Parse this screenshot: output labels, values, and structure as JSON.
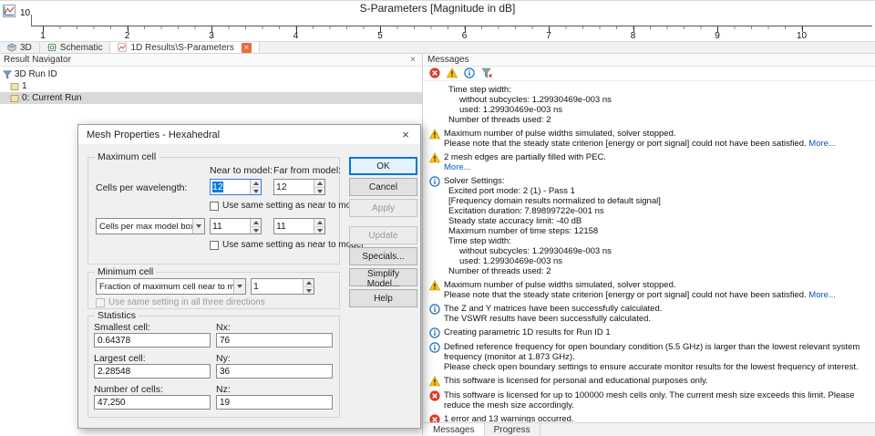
{
  "plot": {
    "title": "S-Parameters [Magnitude in dB]",
    "y_tick_label": "10",
    "x_tick_labels": [
      "1",
      "2",
      "3",
      "4",
      "5",
      "6",
      "7",
      "8",
      "9",
      "10"
    ]
  },
  "doc_tabs": [
    {
      "label": "3D",
      "active": false,
      "closable": false,
      "icon": "cube"
    },
    {
      "label": "Schematic",
      "active": false,
      "closable": false,
      "icon": "schematic"
    },
    {
      "label": "1D Results\\S-Parameters",
      "active": true,
      "closable": true,
      "icon": "chart"
    }
  ],
  "navigator": {
    "title": "Result Navigator",
    "items": [
      {
        "label": "3D Run ID",
        "icon": "funnel",
        "level": 0,
        "selected": false
      },
      {
        "label": "1",
        "icon": "run",
        "level": 1,
        "selected": false
      },
      {
        "label": "0: Current Run",
        "icon": "run",
        "level": 1,
        "selected": true
      }
    ]
  },
  "dialog": {
    "title": "Mesh Properties - Hexahedral",
    "maximum_cell": {
      "group_label": "Maximum cell",
      "col_near": "Near to model:",
      "col_far": "Far from model:",
      "cells_per_wavelength": {
        "label": "Cells per wavelength:",
        "near": "12",
        "far": "12"
      },
      "use_same_1": "Use same setting as near to model",
      "box_edge": {
        "selected": "Cells per max model box edge",
        "near": "11",
        "far": "11"
      },
      "use_same_2": "Use same setting as near to model"
    },
    "minimum_cell": {
      "group_label": "Minimum cell",
      "fraction": {
        "selected": "Fraction of maximum cell near to model",
        "value": "1"
      },
      "use_same_3": "Use same setting in all three directions"
    },
    "statistics": {
      "group_label": "Statistics",
      "smallest_cell": {
        "label": "Smallest cell:",
        "value": "0.64378"
      },
      "nx": {
        "label": "Nx:",
        "value": "76"
      },
      "largest_cell": {
        "label": "Largest cell:",
        "value": "2.28548"
      },
      "ny": {
        "label": "Ny:",
        "value": "36"
      },
      "number_of_cells": {
        "label": "Number of cells:",
        "value": "47,250"
      },
      "nz": {
        "label": "Nz:",
        "value": "19"
      }
    },
    "buttons": {
      "ok": "OK",
      "cancel": "Cancel",
      "apply": "Apply",
      "update": "Update",
      "specials": "Specials...",
      "simplify": "Simplify Model...",
      "help": "Help"
    }
  },
  "messages": {
    "title": "Messages",
    "items": [
      {
        "type": "none",
        "lines": [
          {
            "text": "Time step width:",
            "indent": 1
          },
          {
            "text": "without subcycles: 1.29930469e-003 ns",
            "indent": 2
          },
          {
            "text": "used: 1.29930469e-003 ns",
            "indent": 2
          },
          {
            "text": "Number of threads used: 2",
            "indent": 1
          }
        ]
      },
      {
        "type": "warning",
        "lines": [
          {
            "text": "Maximum number of pulse widths simulated, solver stopped.",
            "indent": 0
          },
          {
            "text": "Please note that the steady state criterion [energy or port signal] could not have been satisfied.",
            "indent": 0,
            "link": "More..."
          }
        ]
      },
      {
        "type": "warning",
        "lines": [
          {
            "text": "2 mesh edges are partially filled with PEC.",
            "indent": 0
          },
          {
            "text": "",
            "indent": 0,
            "link": "More..."
          }
        ]
      },
      {
        "type": "info",
        "lines": [
          {
            "text": "Solver Settings:",
            "indent": 0
          },
          {
            "text": "Excited port mode: 2 (1) - Pass 1",
            "indent": 1
          },
          {
            "text": "[Frequency domain results normalized to default signal]",
            "indent": 1
          },
          {
            "text": "Excitation duration: 7.89899722e-001 ns",
            "indent": 1
          },
          {
            "text": "Steady state accuracy limit: -40 dB",
            "indent": 1
          },
          {
            "text": "Maximum number of time steps: 12158",
            "indent": 1
          },
          {
            "text": "Time step width:",
            "indent": 1
          },
          {
            "text": "without subcycles: 1.29930469e-003 ns",
            "indent": 2
          },
          {
            "text": "used: 1.29930469e-003 ns",
            "indent": 2
          },
          {
            "text": "Number of threads used: 2",
            "indent": 1
          }
        ]
      },
      {
        "type": "warning",
        "lines": [
          {
            "text": "Maximum number of pulse widths simulated, solver stopped.",
            "indent": 0
          },
          {
            "text": "Please note that the steady state criterion [energy or port signal] could not have been satisfied.",
            "indent": 0,
            "link": "More..."
          }
        ]
      },
      {
        "type": "info",
        "lines": [
          {
            "text": "The Z and Y matrices have been successfully calculated.",
            "indent": 0
          },
          {
            "text": "The VSWR results have been successfully calculated.",
            "indent": 0
          }
        ]
      },
      {
        "type": "info",
        "lines": [
          {
            "text": "Creating parametric 1D results for Run ID 1",
            "indent": 0
          }
        ]
      },
      {
        "type": "info",
        "lines": [
          {
            "text": "Defined reference frequency for open boundary condition (5.5 GHz) is larger than the lowest relevant system frequency (monitor at 1.873 GHz).",
            "indent": 0
          },
          {
            "text": "Please check open boundary settings to ensure accurate monitor results for the lowest frequency of interest.",
            "indent": 0
          }
        ]
      },
      {
        "type": "warning",
        "lines": [
          {
            "text": "This software is licensed for personal and educational purposes only.",
            "indent": 0
          }
        ]
      },
      {
        "type": "error",
        "lines": [
          {
            "text": "This software is licensed for up to 100000 mesh cells only. The current mesh size exceeds this limit. Please reduce the mesh size accordingly.",
            "indent": 0
          }
        ]
      },
      {
        "type": "error",
        "lines": [
          {
            "text": "1 error and 13 warnings occurred.",
            "indent": 0
          }
        ]
      }
    ],
    "bottom_tabs": [
      {
        "label": "Messages",
        "active": true
      },
      {
        "label": "Progress",
        "active": false
      }
    ]
  },
  "colors": {
    "accent_blue": "#0078d7",
    "warning_yellow": "#ffc60a",
    "error_red": "#dd3c2a",
    "info_blue": "#1d6fbe",
    "link_blue": "#0a57c2",
    "tab_close_orange": "#ee6b3b"
  }
}
